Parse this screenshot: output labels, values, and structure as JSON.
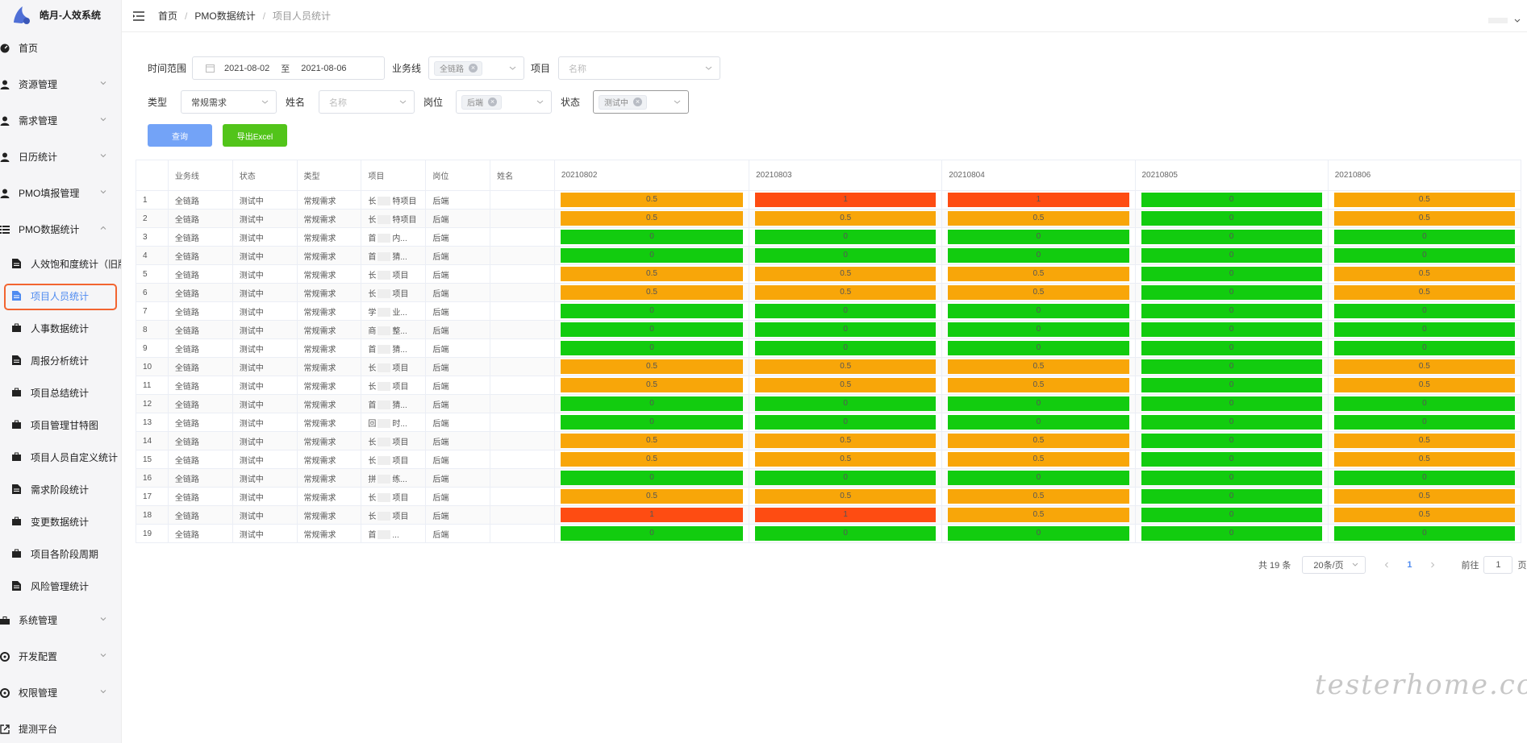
{
  "app": {
    "title": "皓月-人效系统"
  },
  "menu": {
    "home": "首页",
    "resource": "资源管理",
    "demand": "需求管理",
    "calendar": "日历统计",
    "pmo_fill": "PMO填报管理",
    "pmo_data": "PMO数据统计",
    "sub": [
      "人效饱和度统计（旧版",
      "项目人员统计",
      "人事数据统计",
      "周报分析统计",
      "项目总结统计",
      "项目管理甘特图",
      "项目人员自定义统计",
      "需求阶段统计",
      "变更数据统计",
      "项目各阶段周期",
      "风险管理统计"
    ],
    "system": "系统管理",
    "dev": "开发配置",
    "perm": "权限管理",
    "test": "提测平台"
  },
  "breadcrumb": {
    "home": "首页",
    "sep1": "/",
    "section": "PMO数据统计",
    "sep2": "/",
    "current": "项目人员统计"
  },
  "filters": {
    "date_label": "时间范围",
    "date_start": "2021-08-02",
    "date_to": "至",
    "date_end": "2021-08-06",
    "biz_label": "业务线",
    "biz_tag": "全链路",
    "project_label": "项目",
    "project_placeholder": "名称",
    "type_label": "类型",
    "type_value": "常规需求",
    "name_label": "姓名",
    "name_placeholder": "名称",
    "post_label": "岗位",
    "post_tag": "后端",
    "status_label": "状态",
    "status_tag": "测试中",
    "query_button": "查询",
    "export_button": "导出Excel"
  },
  "colors": {
    "orange": "#f8a609",
    "red": "#fe4c12",
    "green": "#12cc0f",
    "blue_btn": "#73a3f7",
    "green_btn": "#52c41a"
  },
  "table": {
    "headers": [
      "",
      "业务线",
      "状态",
      "类型",
      "项目",
      "岗位",
      "姓名",
      "20210802",
      "20210803",
      "20210804",
      "20210805",
      "20210806"
    ],
    "rows": [
      {
        "no": "1",
        "biz": "全链路",
        "status": "测试中",
        "type": "常规需求",
        "p1": "长",
        "p2": "特项目",
        "post": "后端",
        "name": "",
        "v": [
          "0.5",
          "1",
          "1",
          "0",
          "0.5"
        ]
      },
      {
        "no": "2",
        "biz": "全链路",
        "status": "测试中",
        "type": "常规需求",
        "p1": "长",
        "p2": "特项目",
        "post": "后端",
        "name": "",
        "v": [
          "0.5",
          "0.5",
          "0.5",
          "0",
          "0.5"
        ]
      },
      {
        "no": "3",
        "biz": "全链路",
        "status": "测试中",
        "type": "常规需求",
        "p1": "首",
        "p2": "内...",
        "post": "后端",
        "name": "",
        "v": [
          "0",
          "0",
          "0",
          "0",
          "0"
        ]
      },
      {
        "no": "4",
        "biz": "全链路",
        "status": "测试中",
        "type": "常规需求",
        "p1": "首",
        "p2": "猜...",
        "post": "后端",
        "name": "",
        "v": [
          "0",
          "0",
          "0",
          "0",
          "0"
        ]
      },
      {
        "no": "5",
        "biz": "全链路",
        "status": "测试中",
        "type": "常规需求",
        "p1": "长",
        "p2": "项目",
        "post": "后端",
        "name": "",
        "v": [
          "0.5",
          "0.5",
          "0.5",
          "0",
          "0.5"
        ]
      },
      {
        "no": "6",
        "biz": "全链路",
        "status": "测试中",
        "type": "常规需求",
        "p1": "长",
        "p2": "项目",
        "post": "后端",
        "name": "",
        "v": [
          "0.5",
          "0.5",
          "0.5",
          "0",
          "0.5"
        ]
      },
      {
        "no": "7",
        "biz": "全链路",
        "status": "测试中",
        "type": "常规需求",
        "p1": "学",
        "p2": "业...",
        "post": "后端",
        "name": "",
        "v": [
          "0",
          "0",
          "0",
          "0",
          "0"
        ]
      },
      {
        "no": "8",
        "biz": "全链路",
        "status": "测试中",
        "type": "常规需求",
        "p1": "商",
        "p2": "整...",
        "post": "后端",
        "name": "",
        "v": [
          "0",
          "0",
          "0",
          "0",
          "0"
        ]
      },
      {
        "no": "9",
        "biz": "全链路",
        "status": "测试中",
        "type": "常规需求",
        "p1": "首",
        "p2": "猜...",
        "post": "后端",
        "name": "",
        "v": [
          "0",
          "0",
          "0",
          "0",
          "0"
        ]
      },
      {
        "no": "10",
        "biz": "全链路",
        "status": "测试中",
        "type": "常规需求",
        "p1": "长",
        "p2": "项目",
        "post": "后端",
        "name": "",
        "v": [
          "0.5",
          "0.5",
          "0.5",
          "0",
          "0.5"
        ]
      },
      {
        "no": "11",
        "biz": "全链路",
        "status": "测试中",
        "type": "常规需求",
        "p1": "长",
        "p2": "项目",
        "post": "后端",
        "name": "",
        "v": [
          "0.5",
          "0.5",
          "0.5",
          "0",
          "0.5"
        ]
      },
      {
        "no": "12",
        "biz": "全链路",
        "status": "测试中",
        "type": "常规需求",
        "p1": "首",
        "p2": "猜...",
        "post": "后端",
        "name": "",
        "v": [
          "0",
          "0",
          "0",
          "0",
          "0"
        ]
      },
      {
        "no": "13",
        "biz": "全链路",
        "status": "测试中",
        "type": "常规需求",
        "p1": "回",
        "p2": "时...",
        "post": "后端",
        "name": "",
        "v": [
          "0",
          "0",
          "0",
          "0",
          "0"
        ]
      },
      {
        "no": "14",
        "biz": "全链路",
        "status": "测试中",
        "type": "常规需求",
        "p1": "长",
        "p2": "项目",
        "post": "后端",
        "name": "",
        "v": [
          "0.5",
          "0.5",
          "0.5",
          "0",
          "0.5"
        ]
      },
      {
        "no": "15",
        "biz": "全链路",
        "status": "测试中",
        "type": "常规需求",
        "p1": "长",
        "p2": "项目",
        "post": "后端",
        "name": "",
        "v": [
          "0.5",
          "0.5",
          "0.5",
          "0",
          "0.5"
        ]
      },
      {
        "no": "16",
        "biz": "全链路",
        "status": "测试中",
        "type": "常规需求",
        "p1": "拼",
        "p2": "练...",
        "post": "后端",
        "name": "",
        "v": [
          "0",
          "0",
          "0",
          "0",
          "0"
        ]
      },
      {
        "no": "17",
        "biz": "全链路",
        "status": "测试中",
        "type": "常规需求",
        "p1": "长",
        "p2": "项目",
        "post": "后端",
        "name": "",
        "v": [
          "0.5",
          "0.5",
          "0.5",
          "0",
          "0.5"
        ]
      },
      {
        "no": "18",
        "biz": "全链路",
        "status": "测试中",
        "type": "常规需求",
        "p1": "长",
        "p2": "项目",
        "post": "后端",
        "name": "",
        "v": [
          "1",
          "1",
          "0.5",
          "0",
          "0.5"
        ]
      },
      {
        "no": "19",
        "biz": "全链路",
        "status": "测试中",
        "type": "常规需求",
        "p1": "首",
        "p2": "...",
        "post": "后端",
        "name": "",
        "v": [
          "0",
          "0",
          "0",
          "0",
          "0"
        ]
      }
    ]
  },
  "pager": {
    "total": "共 19 条",
    "size": "20条/页",
    "page": "1",
    "goto": "前往",
    "goto_value": "1",
    "unit": "页"
  },
  "watermark": "testerhome.com"
}
